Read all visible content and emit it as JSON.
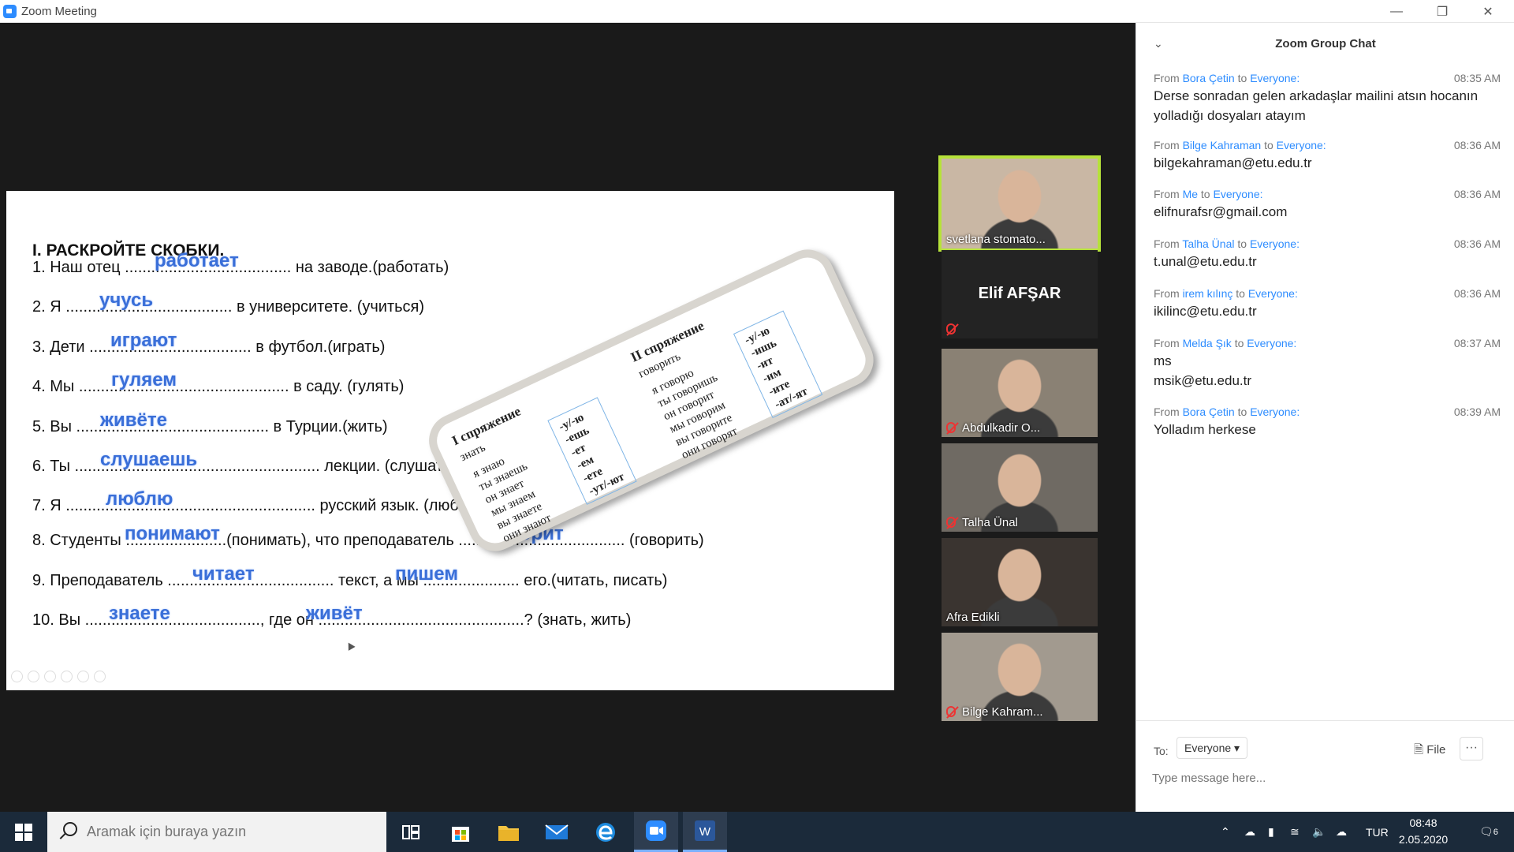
{
  "window": {
    "title": "Zoom Meeting"
  },
  "slide": {
    "heading": "I. РАСКРОЙТЕ СКОБКИ.",
    "exercises": [
      {
        "text": "1. Наш отец ...................................... на заводе.(работать)",
        "answer": "работает"
      },
      {
        "text": "2. Я ...................................... в университете. (учиться)",
        "answer": "учусь"
      },
      {
        "text": "3. Дети ..................................... в футбол.(играть)",
        "answer": "играют"
      },
      {
        "text": "4. Мы ................................................ в саду. (гулять)",
        "answer": "гуляем"
      },
      {
        "text": "5. Вы ............................................ в Турции.(жить)",
        "answer": "живёте"
      },
      {
        "text": "6. Ты ........................................................ лекции. (слушать)",
        "answer": "слушаешь"
      },
      {
        "text": "7. Я ......................................................... русский язык. (любить)",
        "answer": "люблю"
      },
      {
        "text": "8. Студенты .......................(понимать), что преподаватель ...................................... (говорить)",
        "answer": "понимают",
        "answer2": "говорит"
      },
      {
        "text": "9. Преподаватель ...................................... текст, а мы ...................... его.(читать, писать)",
        "answer": "читает",
        "answer2": "пишем"
      },
      {
        "text": "10. Вы ........................................, где он ...............................................? (знать, жить)",
        "answer": "знаете",
        "answer2": "живёт"
      }
    ],
    "card": {
      "left_title": "I спряжение",
      "left_verb": "знать",
      "left_forms": [
        "я знаю",
        "ты знаешь",
        "он знает",
        "мы знаем",
        "вы знаете",
        "они знают"
      ],
      "left_endings": [
        "-у/-ю",
        "-ешь",
        "-ет",
        "-ем",
        "-ете",
        "-ут/-ют"
      ],
      "right_title": "II спряжение",
      "right_verb": "говорить",
      "right_forms": [
        "я говорю",
        "ты говоришь",
        "он говорит",
        "мы говорим",
        "вы говорите",
        "они говорят"
      ],
      "right_endings": [
        "-у/-ю",
        "-ишь",
        "-ит",
        "-им",
        "-ите",
        "-ат/-ят"
      ]
    }
  },
  "participants": [
    {
      "name": "svetlana stomato...",
      "muted": false,
      "active": true,
      "bg": "#c9b7a4"
    },
    {
      "name": "Elif AFŞAR",
      "muted": true,
      "active": false,
      "bg": "#222222",
      "name_only": true
    },
    {
      "name": "Abdulkadir O...",
      "muted": true,
      "active": false,
      "bg": "#8a8174"
    },
    {
      "name": "Talha Ünal",
      "muted": true,
      "active": false,
      "bg": "#6f6a63"
    },
    {
      "name": "Afra Edikli",
      "muted": false,
      "active": false,
      "bg": "#3a3430"
    },
    {
      "name": "Bilge Kahram...",
      "muted": true,
      "active": false,
      "bg": "#a29a8f"
    }
  ],
  "chat": {
    "title": "Zoom Group Chat",
    "messages": [
      {
        "from_label": "From",
        "sender": "Bora Çetin",
        "to_label": "to",
        "recipient": "Everyone:",
        "time": "08:35 AM",
        "text": "Derse sonradan gelen arkadaşlar mailini atsın hocanın yolladığı dosyaları atayım"
      },
      {
        "from_label": "From",
        "sender": "Bilge Kahraman",
        "to_label": "to",
        "recipient": "Everyone:",
        "time": "08:36 AM",
        "text": "bilgekahraman@etu.edu.tr"
      },
      {
        "from_label": "From",
        "sender": "Me",
        "to_label": "to",
        "recipient": "Everyone:",
        "time": "08:36 AM",
        "text": "elifnurafsr@gmail.com"
      },
      {
        "from_label": "From",
        "sender": "Talha Ünal",
        "to_label": "to",
        "recipient": "Everyone:",
        "time": "08:36 AM",
        "text": "t.unal@etu.edu.tr"
      },
      {
        "from_label": "From",
        "sender": "irem kılınç",
        "to_label": "to",
        "recipient": "Everyone:",
        "time": "08:36 AM",
        "text": "ikilinc@etu.edu.tr"
      },
      {
        "from_label": "From",
        "sender": "Melda Şık",
        "to_label": "to",
        "recipient": "Everyone:",
        "time": "08:37 AM",
        "text": "ms\nmsik@etu.edu.tr"
      },
      {
        "from_label": "From",
        "sender": "Bora Çetin",
        "to_label": "to",
        "recipient": "Everyone:",
        "time": "08:39 AM",
        "text": "Yolladım herkese"
      }
    ],
    "to_label": "To:",
    "to_value": "Everyone",
    "file_label": "File",
    "more_label": "···",
    "input_placeholder": "Type message here..."
  },
  "taskbar": {
    "search_placeholder": "Aramak için buraya yazın",
    "language": "TUR",
    "time": "08:48",
    "date": "2.05.2020",
    "notification_count": "6"
  },
  "colors": {
    "accent": "#2d8cff",
    "answer": "#3a6fd8",
    "active_speaker": "#b6e23a",
    "mute": "#e33333"
  }
}
